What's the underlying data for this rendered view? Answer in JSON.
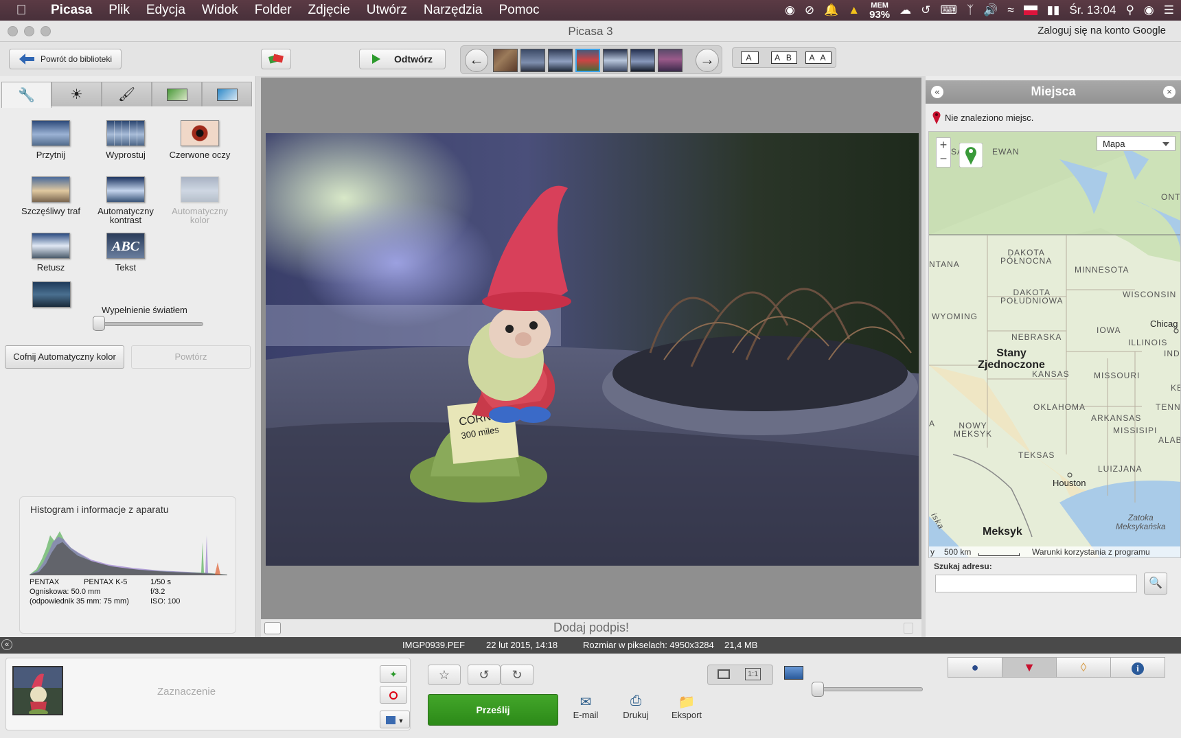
{
  "menubar": {
    "app": "Picasa",
    "items": [
      "Plik",
      "Edycja",
      "Widok",
      "Folder",
      "Zdjęcie",
      "Utwórz",
      "Narzędzia",
      "Pomoc"
    ],
    "mem_label": "MEM",
    "mem_value": "93%",
    "clock": "Śr. 13:04"
  },
  "window": {
    "title": "Picasa 3",
    "login_link": "Zaloguj się na konto Google"
  },
  "toolbar": {
    "back_label": "Powrót do biblioteki",
    "play_label": "Odtwórz",
    "view_modes": [
      "A",
      "A B",
      "A A"
    ]
  },
  "edit_tools": [
    {
      "label": "Przytnij",
      "disabled": false
    },
    {
      "label": "Wyprostuj",
      "disabled": false
    },
    {
      "label": "Czerwone oczy",
      "disabled": false
    },
    {
      "label": "Szczęśliwy traf",
      "disabled": false
    },
    {
      "label": "Automatyczny kontrast",
      "disabled": false
    },
    {
      "label": "Automatyczny kolor",
      "disabled": true
    },
    {
      "label": "Retusz",
      "disabled": false
    },
    {
      "label": "Tekst",
      "disabled": false
    }
  ],
  "text_tool_glyph": "ABC",
  "fill_light": {
    "label": "Wypełnienie światłem",
    "value": 0
  },
  "actions": {
    "undo_label": "Cofnij Automatyczny kolor",
    "redo_label": "Powtórz"
  },
  "histogram": {
    "title": "Histogram i informacje z aparatu",
    "make": "PENTAX",
    "model": "PENTAX K-5",
    "focal": "Ogniskowa: 50.0 mm",
    "focal35": "(odpowiednik 35 mm:  75 mm)",
    "shutter": "1/50 s",
    "aperture": "f/3.2",
    "iso": "ISO: 100"
  },
  "photo": {
    "sign_line1": "CORNWALL",
    "sign_line2": "300 miles"
  },
  "caption": {
    "placeholder": "Dodaj podpis!"
  },
  "places": {
    "title": "Miejsca",
    "not_found": "Nie znaleziono miejsc.",
    "map_type": "Mapa",
    "map_labels": {
      "sask": "SASK",
      "ewan": "EWAN",
      "ont": "ONT.",
      "dakota_n": "DAKOTA\nPÓŁNOCNA",
      "minnesota": "MINNESOTA",
      "ntana": "NTANA",
      "dakota_s": "DAKOTA\nPOŁUDNIOWA",
      "wisconsin": "WISCONSIN",
      "wyoming": "WYOMING",
      "nebraska": "NEBRASKA",
      "iowa": "IOWA",
      "chicago": "Chicag",
      "illinois": "ILLINOIS",
      "usa": "Stany\nZjednoczone",
      "ind": "IND",
      "kansas": "KANSAS",
      "missouri": "MISSOURI",
      "ke": "KE",
      "oklahoma": "OKLAHOMA",
      "tenne": "TENNE",
      "arkansas": "ARKANSAS",
      "a": "A",
      "nm": "NOWY\nMEKSYK",
      "missisipi": "MISSISIPI",
      "alab": "ALAB",
      "teksas": "TEKSAS",
      "luizjana": "LUIZJANA",
      "houston": "Houston",
      "iska": "iska",
      "gulf": "Zatoka\nMeksykańska",
      "meksyk": "Meksyk"
    },
    "scale": "500 km",
    "terms": "Warunki korzystania z programu",
    "scale_prefix": "y",
    "search_label": "Szukaj adresu:",
    "search_value": ""
  },
  "status": {
    "filename": "IMGP0939.PEF",
    "date": "22 lut 2015, 14:18",
    "pixels": "Rozmiar w pikselach: 4950x3284",
    "size": "21,4 MB"
  },
  "tray": {
    "selection_label": "Zaznaczenie",
    "upload_label": "Prześlij",
    "email_label": "E-mail",
    "print_label": "Drukuj",
    "export_label": "Eksport",
    "zoom_1to1": "1:1"
  },
  "colors": {
    "accent_green": "#2c8a18",
    "menubar": "#4f343e",
    "status_bar": "#4a4a4a"
  }
}
